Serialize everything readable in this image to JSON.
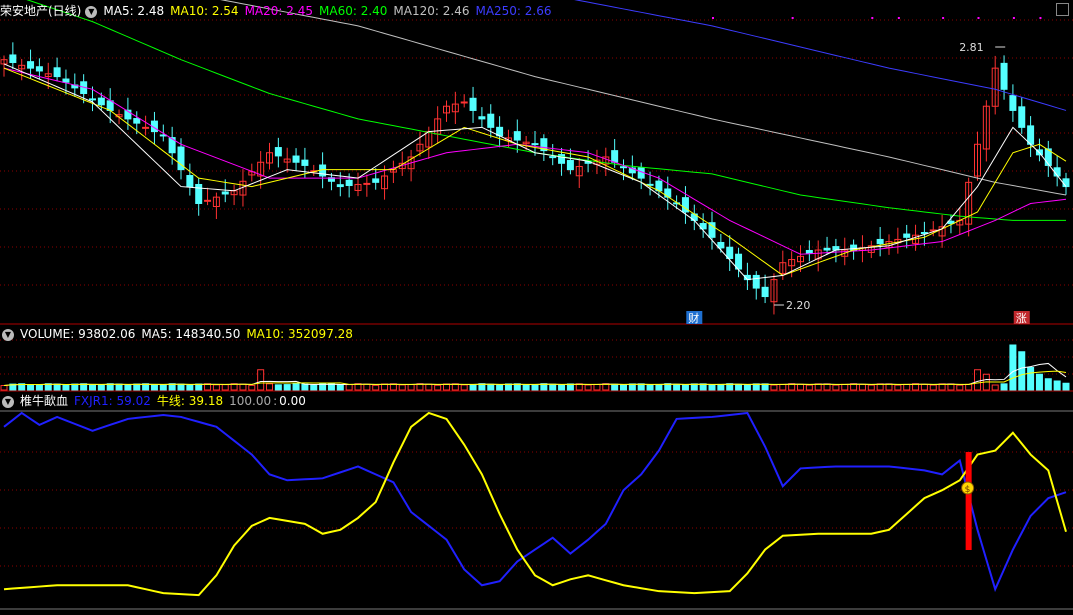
{
  "price_panel": {
    "title": "荣安地产(日线)",
    "ma5": "MA5: 2.48",
    "ma10": "MA10: 2.54",
    "ma20": "MA20: 2.45",
    "ma60": "MA60: 2.40",
    "ma120": "MA120: 2.46",
    "ma250": "MA250: 2.66",
    "high_label": "2.81",
    "low_label": "2.20",
    "marker_cai": "财",
    "marker_zhang": "涨"
  },
  "volume_panel": {
    "volume": "VOLUME: 93802.06",
    "ma5": "MA5: 148340.50",
    "ma10": "MA10: 352097.28"
  },
  "indicator_panel": {
    "name": "椎牛歃血",
    "fxjr1": "FXJR1: 59.02",
    "niuxian": "牛线: 39.18",
    "level100": "100.00",
    "level0": "0.00",
    "badge": "$"
  },
  "colors": {
    "up": "#ff3232",
    "down": "#54ffff",
    "ma5": "#ffffff",
    "ma10": "#ffff00",
    "ma20": "#ff00ff",
    "ma60": "#00ff00",
    "ma120": "#c0c0c0",
    "ma250": "#3c3cff",
    "fxjr1": "#2020ff",
    "niuxian": "#ffff00",
    "grid": "#8b0000"
  },
  "chart_data": [
    {
      "type": "candlestick",
      "title": "荣安地产(日线)",
      "annotations": [
        {
          "label": "2.81",
          "value": 2.81
        },
        {
          "label": "2.20",
          "value": 2.2
        }
      ],
      "close_keypoints": [
        [
          0,
          2.78
        ],
        [
          6,
          2.74
        ],
        [
          12,
          2.66
        ],
        [
          18,
          2.6
        ],
        [
          22,
          2.44
        ],
        [
          26,
          2.47
        ],
        [
          30,
          2.56
        ],
        [
          34,
          2.53
        ],
        [
          38,
          2.48
        ],
        [
          42,
          2.49
        ],
        [
          46,
          2.55
        ],
        [
          50,
          2.67
        ],
        [
          52,
          2.68
        ],
        [
          56,
          2.6
        ],
        [
          60,
          2.58
        ],
        [
          64,
          2.52
        ],
        [
          68,
          2.55
        ],
        [
          72,
          2.5
        ],
        [
          76,
          2.44
        ],
        [
          80,
          2.36
        ],
        [
          84,
          2.26
        ],
        [
          86,
          2.22
        ],
        [
          88,
          2.3
        ],
        [
          92,
          2.33
        ],
        [
          96,
          2.33
        ],
        [
          100,
          2.35
        ],
        [
          104,
          2.37
        ],
        [
          108,
          2.4
        ],
        [
          110,
          2.58
        ],
        [
          112,
          2.76
        ],
        [
          114,
          2.66
        ],
        [
          116,
          2.58
        ],
        [
          118,
          2.53
        ],
        [
          120,
          2.48
        ]
      ],
      "ma5_keypoints": [
        [
          0,
          2.77
        ],
        [
          10,
          2.68
        ],
        [
          20,
          2.48
        ],
        [
          26,
          2.47
        ],
        [
          32,
          2.52
        ],
        [
          40,
          2.5
        ],
        [
          48,
          2.61
        ],
        [
          54,
          2.62
        ],
        [
          60,
          2.56
        ],
        [
          66,
          2.54
        ],
        [
          72,
          2.49
        ],
        [
          78,
          2.4
        ],
        [
          84,
          2.26
        ],
        [
          88,
          2.27
        ],
        [
          94,
          2.33
        ],
        [
          100,
          2.34
        ],
        [
          106,
          2.38
        ],
        [
          110,
          2.48
        ],
        [
          114,
          2.62
        ],
        [
          117,
          2.56
        ],
        [
          120,
          2.48
        ]
      ],
      "ma10_keypoints": [
        [
          0,
          2.76
        ],
        [
          12,
          2.66
        ],
        [
          22,
          2.5
        ],
        [
          28,
          2.48
        ],
        [
          36,
          2.52
        ],
        [
          44,
          2.52
        ],
        [
          52,
          2.62
        ],
        [
          58,
          2.58
        ],
        [
          66,
          2.55
        ],
        [
          74,
          2.47
        ],
        [
          82,
          2.36
        ],
        [
          88,
          2.27
        ],
        [
          96,
          2.33
        ],
        [
          104,
          2.36
        ],
        [
          110,
          2.42
        ],
        [
          114,
          2.56
        ],
        [
          117,
          2.58
        ],
        [
          120,
          2.54
        ]
      ],
      "ma20_keypoints": [
        [
          0,
          2.76
        ],
        [
          10,
          2.71
        ],
        [
          20,
          2.58
        ],
        [
          30,
          2.5
        ],
        [
          40,
          2.5
        ],
        [
          50,
          2.56
        ],
        [
          58,
          2.58
        ],
        [
          66,
          2.56
        ],
        [
          74,
          2.5
        ],
        [
          82,
          2.4
        ],
        [
          90,
          2.32
        ],
        [
          98,
          2.33
        ],
        [
          106,
          2.35
        ],
        [
          112,
          2.4
        ],
        [
          116,
          2.44
        ],
        [
          120,
          2.45
        ]
      ],
      "ma60_keypoints": [
        [
          0,
          2.94
        ],
        [
          10,
          2.87
        ],
        [
          20,
          2.78
        ],
        [
          30,
          2.7
        ],
        [
          40,
          2.64
        ],
        [
          50,
          2.6
        ],
        [
          60,
          2.56
        ],
        [
          70,
          2.53
        ],
        [
          80,
          2.51
        ],
        [
          90,
          2.46
        ],
        [
          100,
          2.43
        ],
        [
          108,
          2.41
        ],
        [
          114,
          2.4
        ],
        [
          120,
          2.4
        ]
      ],
      "ma120_keypoints": [
        [
          0,
          2.98
        ],
        [
          20,
          2.94
        ],
        [
          40,
          2.86
        ],
        [
          60,
          2.74
        ],
        [
          80,
          2.64
        ],
        [
          100,
          2.55
        ],
        [
          112,
          2.49
        ],
        [
          120,
          2.46
        ]
      ],
      "ma250_keypoints": [
        [
          0,
          3.03
        ],
        [
          20,
          3.0
        ],
        [
          40,
          2.98
        ],
        [
          60,
          2.94
        ],
        [
          80,
          2.86
        ],
        [
          100,
          2.76
        ],
        [
          112,
          2.71
        ],
        [
          120,
          2.66
        ]
      ]
    },
    {
      "type": "bar",
      "title": "VOLUME",
      "description_values": {
        "latest": 93802.06,
        "ma5": 148340.5,
        "ma10": 352097.28
      }
    },
    {
      "type": "line",
      "title": "椎牛歃血",
      "ylim": [
        0,
        100
      ],
      "series": [
        {
          "name": "FXJR1",
          "value": 59.02,
          "keypoints": [
            [
              0,
              92
            ],
            [
              2,
              99
            ],
            [
              4,
              93
            ],
            [
              6,
              97
            ],
            [
              10,
              90
            ],
            [
              14,
              96
            ],
            [
              18,
              98
            ],
            [
              20,
              97
            ],
            [
              24,
              92
            ],
            [
              26,
              85
            ],
            [
              28,
              78
            ],
            [
              30,
              68
            ],
            [
              32,
              65
            ],
            [
              36,
              66
            ],
            [
              40,
              72
            ],
            [
              44,
              64
            ],
            [
              46,
              49
            ],
            [
              48,
              42
            ],
            [
              50,
              35
            ],
            [
              52,
              20
            ],
            [
              54,
              12
            ],
            [
              56,
              14
            ],
            [
              58,
              24
            ],
            [
              60,
              30
            ],
            [
              62,
              36
            ],
            [
              64,
              28
            ],
            [
              66,
              35
            ],
            [
              68,
              43
            ],
            [
              70,
              60
            ],
            [
              72,
              68
            ],
            [
              74,
              80
            ],
            [
              76,
              96
            ],
            [
              80,
              97
            ],
            [
              84,
              99
            ],
            [
              86,
              82
            ],
            [
              88,
              62
            ],
            [
              90,
              71
            ],
            [
              94,
              72
            ],
            [
              98,
              72
            ],
            [
              100,
              72
            ],
            [
              104,
              70
            ],
            [
              106,
              68
            ],
            [
              108,
              75
            ],
            [
              110,
              40
            ],
            [
              112,
              10
            ],
            [
              114,
              30
            ],
            [
              116,
              47
            ],
            [
              118,
              56
            ],
            [
              120,
              59
            ]
          ]
        },
        {
          "name": "牛线",
          "value": 39.18,
          "keypoints": [
            [
              0,
              10
            ],
            [
              6,
              12
            ],
            [
              14,
              12
            ],
            [
              18,
              8
            ],
            [
              22,
              7
            ],
            [
              24,
              17
            ],
            [
              26,
              32
            ],
            [
              28,
              42
            ],
            [
              30,
              46
            ],
            [
              34,
              43
            ],
            [
              36,
              38
            ],
            [
              38,
              40
            ],
            [
              40,
              46
            ],
            [
              42,
              54
            ],
            [
              44,
              74
            ],
            [
              46,
              92
            ],
            [
              48,
              99
            ],
            [
              50,
              96
            ],
            [
              52,
              83
            ],
            [
              54,
              68
            ],
            [
              56,
              48
            ],
            [
              58,
              30
            ],
            [
              60,
              17
            ],
            [
              62,
              12
            ],
            [
              64,
              15
            ],
            [
              66,
              17
            ],
            [
              70,
              12
            ],
            [
              74,
              9
            ],
            [
              78,
              8
            ],
            [
              82,
              9
            ],
            [
              84,
              18
            ],
            [
              86,
              30
            ],
            [
              88,
              37
            ],
            [
              92,
              38
            ],
            [
              98,
              38
            ],
            [
              100,
              40
            ],
            [
              102,
              48
            ],
            [
              104,
              56
            ],
            [
              106,
              60
            ],
            [
              108,
              65
            ],
            [
              110,
              78
            ],
            [
              112,
              80
            ],
            [
              114,
              89
            ],
            [
              116,
              78
            ],
            [
              118,
              70
            ],
            [
              120,
              39
            ]
          ]
        }
      ]
    }
  ]
}
